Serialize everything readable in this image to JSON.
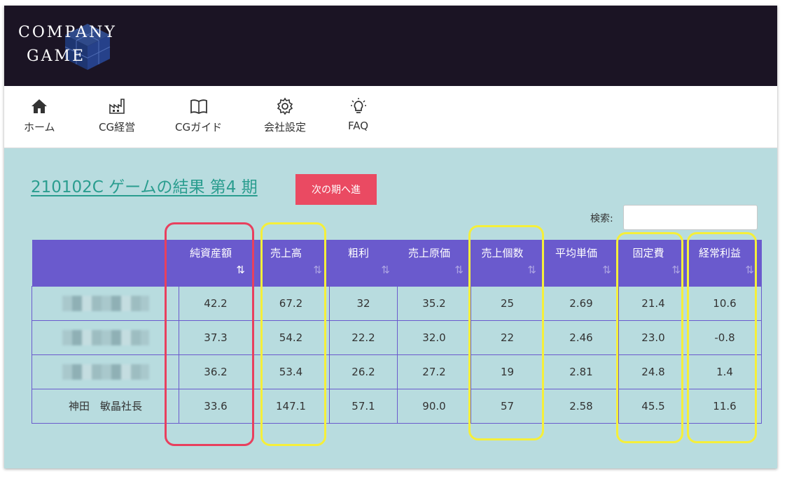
{
  "logo": {
    "line1": "COMPANY",
    "line2": "GAME"
  },
  "nav": [
    {
      "label": "ホーム",
      "icon": "home-icon"
    },
    {
      "label": "CG経営",
      "icon": "factory-icon"
    },
    {
      "label": "CGガイド",
      "icon": "book-icon"
    },
    {
      "label": "会社設定",
      "icon": "gear-icon"
    },
    {
      "label": "FAQ",
      "icon": "lightbulb-icon"
    }
  ],
  "page_title": "210102C ゲームの結果 第4 期",
  "next_button": "次の期へ進",
  "search": {
    "label": "検索:",
    "value": ""
  },
  "table": {
    "columns": [
      "",
      "純資産額",
      "売上高",
      "粗利",
      "売上原価",
      "売上個数",
      "平均単価",
      "固定費",
      "経常利益"
    ],
    "sort_icon": "⇅",
    "active_sort_icon": "⇅",
    "rows": [
      {
        "name": "",
        "values": [
          "42.2",
          "67.2",
          "32",
          "35.2",
          "25",
          "2.69",
          "21.4",
          "10.6"
        ]
      },
      {
        "name": "",
        "values": [
          "37.3",
          "54.2",
          "22.2",
          "32.0",
          "22",
          "2.46",
          "23.0",
          "-0.8"
        ]
      },
      {
        "name": "",
        "values": [
          "36.2",
          "53.4",
          "26.2",
          "27.2",
          "19",
          "2.81",
          "24.8",
          "1.4"
        ]
      },
      {
        "name": "神田　敏晶社長",
        "values": [
          "33.6",
          "147.1",
          "57.1",
          "90.0",
          "57",
          "2.58",
          "45.5",
          "11.6"
        ]
      }
    ]
  },
  "colors": {
    "header_bg": "#1b1424",
    "content_bg": "#b8dcdf",
    "table_header": "#6a5acd",
    "button": "#ea4a62",
    "highlight_yellow": "#f5ef3a",
    "highlight_red": "#e8405e"
  }
}
